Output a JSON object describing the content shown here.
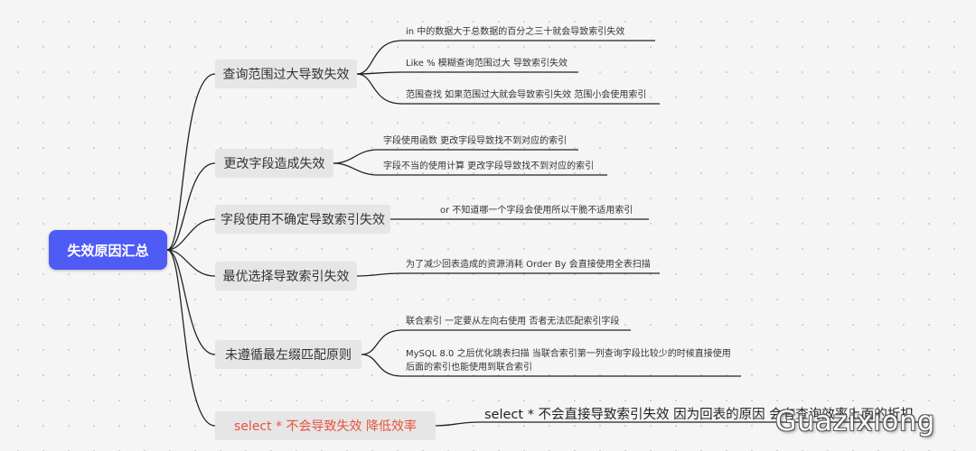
{
  "root": {
    "label": "失效原因汇总"
  },
  "branches": [
    {
      "label": "查询范围过大导致失效",
      "leaves": [
        "in 中的数据大于总数据的百分之三十就会导致索引失效",
        "Like %  模糊查询范围过大 导致索引失效",
        "范围查找 如果范围过大就会导致索引失效 范围小会使用索引"
      ]
    },
    {
      "label": "更改字段造成失效",
      "leaves": [
        "字段使用函数 更改字段导致找不到对应的索引",
        "字段不当的使用计算 更改字段导致找不到对应的索引"
      ]
    },
    {
      "label": "字段使用不确定导致索引失效",
      "leaves": [
        "or  不知道哪一个字段会使用所以干脆不适用索引"
      ]
    },
    {
      "label": "最优选择导致索引失效",
      "leaves": [
        "为了减少回表造成的资源消耗 Order By 会直接使用全表扫描"
      ]
    },
    {
      "label": "未遵循最左缀匹配原则",
      "leaves": [
        "联合索引 一定要从左向右使用 否者无法匹配索引字段",
        "MySQL 8.0 之后优化跳表扫描  当联合索引第一列查询字段比较少的时候直接使用",
        "后面的索引也能使用到联合索引"
      ]
    },
    {
      "label": "select *  不会导致失效 降低效率",
      "note": "select *  不会直接导致索引失效  因为回表的原因 会有查询效率上面的折扣"
    }
  ],
  "watermark": "Guazixiong",
  "colors": {
    "root": "#4f5bf5",
    "branch_bg": "#e6e6e6",
    "connector": "#222222",
    "highlight": "#e8513e"
  }
}
